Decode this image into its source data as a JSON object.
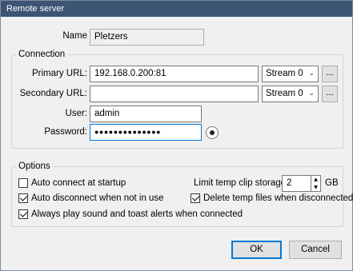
{
  "window": {
    "title": "Remote server"
  },
  "name": {
    "label": "Name",
    "value": "Pletzers"
  },
  "connection": {
    "title": "Connection",
    "primary_url": {
      "label": "Primary URL:",
      "value": "192.168.0.200:81",
      "stream": "Stream 0",
      "browse": "..."
    },
    "secondary_url": {
      "label": "Secondary URL:",
      "value": "",
      "stream": "Stream 0",
      "browse": "..."
    },
    "user": {
      "label": "User:",
      "value": "admin"
    },
    "password": {
      "label": "Password:",
      "value": "●●●●●●●●●●●●●●"
    }
  },
  "options": {
    "title": "Options",
    "auto_connect": {
      "label": "Auto connect at startup",
      "checked": false
    },
    "auto_disconnect": {
      "label": "Auto disconnect when not in use",
      "checked": true
    },
    "always_play": {
      "label": "Always play sound and toast alerts when connected",
      "checked": true
    },
    "limit_storage": {
      "label": "Limit temp clip storage:",
      "value": "2",
      "unit": "GB"
    },
    "delete_temp": {
      "label": "Delete temp files when disconnected",
      "checked": true
    }
  },
  "buttons": {
    "ok": "OK",
    "cancel": "Cancel"
  },
  "colors": {
    "titlebar": "#3b5573",
    "focus": "#0078d7",
    "panel": "#f0f0f0"
  }
}
